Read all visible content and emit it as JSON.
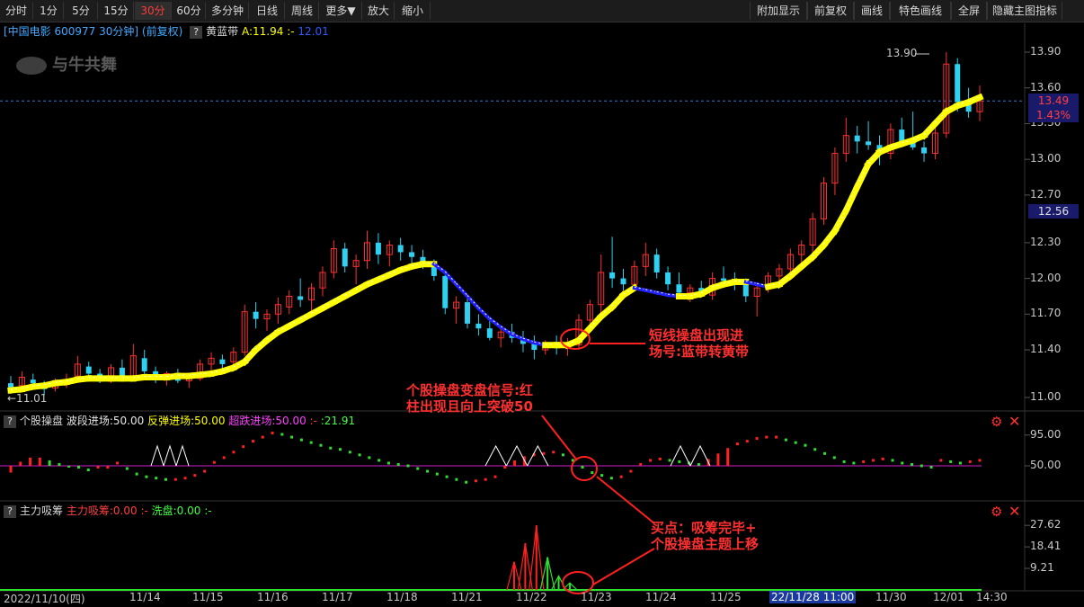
{
  "toolbar": {
    "left": [
      "分时",
      "1分",
      "5分",
      "15分",
      "30分",
      "60分",
      "多分钟",
      "日线",
      "周线",
      "更多▼",
      "放大",
      "缩小"
    ],
    "active_index": 4,
    "right": [
      "附加显示",
      "前复权",
      "画线",
      "特色画线",
      "全屏",
      "隐藏主图指标"
    ]
  },
  "header": {
    "stock": "[中国电影 600977 30分钟]",
    "adjust": "(前复权)",
    "qm": "?",
    "indicator": "黄蓝带",
    "a_value": "A:11.94",
    "b_value": ":-",
    "c_value": "12.01",
    "watermark": "与牛共舞"
  },
  "main_axis": {
    "ticks": [
      "13.90",
      "13.60",
      "13.30",
      "13.00",
      "12.70",
      "12.30",
      "12.00",
      "11.70",
      "11.40",
      "11.00"
    ],
    "current_price": "13.49",
    "current_pct": "1.43%",
    "level": "12.56",
    "high_label": "13.90",
    "low_label": "11.01"
  },
  "sub1": {
    "title": "个股操盘",
    "l1": "波段进场:50.00",
    "l2": "反弹进场:50.00",
    "l3": "超跌进场:50.00",
    "l4": ":-",
    "l5": ":21.91",
    "ticks": [
      "95.00",
      "50.00"
    ],
    "colors": {
      "l1": "#e6e6e6",
      "l2": "#ffff00",
      "l3": "#ff40ff",
      "l5": "#40ff40"
    }
  },
  "sub2": {
    "title": "主力吸筹",
    "l1": "主力吸筹:0.00",
    "l2": ":-",
    "l3": "洗盘:0.00",
    "l4": ":-",
    "ticks": [
      "27.62",
      "18.41",
      "9.21"
    ]
  },
  "x_axis": {
    "labels": [
      "2022/11/10(四)",
      "11/14",
      "11/15",
      "11/16",
      "11/17",
      "11/18",
      "11/21",
      "11/22",
      "11/23",
      "11/24",
      "11/25",
      "11/28",
      "11/30",
      "12/01",
      "14:30"
    ],
    "cursor_label": "22/11/28 11:00"
  },
  "annotations": {
    "a1_l1": "短线操盘出现进",
    "a1_l2": "场号:蓝带转黄带",
    "a2_l1": "个股操盘变盘信号:红",
    "a2_l2": "柱出现且向上突破50",
    "a3_l1": "买点：吸筹完毕+",
    "a3_l2": "个股操盘主题上移"
  },
  "chart_data": [
    {
      "type": "candlestick",
      "title": "中国电影 600977 30分钟",
      "ylim": [
        11.0,
        13.9
      ],
      "series": [
        {
          "name": "黄蓝带",
          "values": [
            11.06,
            11.07,
            11.09,
            11.1,
            11.12,
            11.13,
            11.15,
            11.16,
            11.16,
            11.16,
            11.16,
            11.16,
            11.17,
            11.17,
            11.17,
            11.18,
            11.18,
            11.19,
            11.2,
            11.22,
            11.25,
            11.3,
            11.4,
            11.48,
            11.55,
            11.6,
            11.65,
            11.7,
            11.75,
            11.8,
            11.85,
            11.9,
            11.95,
            11.99,
            12.03,
            12.07,
            12.1,
            12.12,
            12.12,
            12.05,
            11.95,
            11.85,
            11.75,
            11.66,
            11.59,
            11.53,
            11.49,
            11.46,
            11.44,
            11.44,
            11.44,
            11.48,
            11.58,
            11.68,
            11.76,
            11.86,
            11.92,
            11.9,
            11.88,
            11.86,
            11.85,
            11.85,
            11.87,
            11.92,
            11.95,
            11.97,
            11.97,
            11.95,
            11.93,
            11.95,
            12.02,
            12.1,
            12.18,
            12.28,
            12.4,
            12.57,
            12.77,
            12.96,
            13.06,
            13.1,
            13.13,
            13.16,
            13.2,
            13.3,
            13.4,
            13.45,
            13.48,
            13.52
          ]
        }
      ],
      "ohlc": [
        [
          11.12,
          11.18,
          11.03,
          11.08
        ],
        [
          11.1,
          11.22,
          11.05,
          11.17
        ],
        [
          11.15,
          11.2,
          11.08,
          11.12
        ],
        [
          11.1,
          11.14,
          11.02,
          11.07
        ],
        [
          11.08,
          11.16,
          11.05,
          11.13
        ],
        [
          11.12,
          11.2,
          11.08,
          11.15
        ],
        [
          11.18,
          11.35,
          11.15,
          11.28
        ],
        [
          11.26,
          11.3,
          11.16,
          11.2
        ],
        [
          11.2,
          11.24,
          11.12,
          11.15
        ],
        [
          11.15,
          11.28,
          11.12,
          11.25
        ],
        [
          11.25,
          11.32,
          11.15,
          11.18
        ],
        [
          11.17,
          11.45,
          11.15,
          11.35
        ],
        [
          11.33,
          11.4,
          11.18,
          11.22
        ],
        [
          11.22,
          11.26,
          11.12,
          11.16
        ],
        [
          11.16,
          11.22,
          11.1,
          11.2
        ],
        [
          11.18,
          11.24,
          11.12,
          11.14
        ],
        [
          11.14,
          11.2,
          11.08,
          11.17
        ],
        [
          11.16,
          11.32,
          11.14,
          11.28
        ],
        [
          11.28,
          11.38,
          11.22,
          11.33
        ],
        [
          11.32,
          11.36,
          11.24,
          11.28
        ],
        [
          11.3,
          11.42,
          11.26,
          11.38
        ],
        [
          11.38,
          11.78,
          11.35,
          11.72
        ],
        [
          11.72,
          11.8,
          11.58,
          11.66
        ],
        [
          11.66,
          11.74,
          11.56,
          11.7
        ],
        [
          11.7,
          11.84,
          11.62,
          11.78
        ],
        [
          11.76,
          11.9,
          11.7,
          11.85
        ],
        [
          11.85,
          12.0,
          11.76,
          11.82
        ],
        [
          11.82,
          11.96,
          11.7,
          11.92
        ],
        [
          11.92,
          12.1,
          11.85,
          12.05
        ],
        [
          12.05,
          12.32,
          12.0,
          12.25
        ],
        [
          12.25,
          12.3,
          12.05,
          12.1
        ],
        [
          12.1,
          12.2,
          11.95,
          12.15
        ],
        [
          12.15,
          12.4,
          12.08,
          12.3
        ],
        [
          12.3,
          12.38,
          12.12,
          12.2
        ],
        [
          12.2,
          12.32,
          12.1,
          12.28
        ],
        [
          12.28,
          12.34,
          12.15,
          12.22
        ],
        [
          12.22,
          12.28,
          12.1,
          12.18
        ],
        [
          12.18,
          12.24,
          12.08,
          12.12
        ],
        [
          12.12,
          12.16,
          11.98,
          12.02
        ],
        [
          12.02,
          12.06,
          11.7,
          11.75
        ],
        [
          11.75,
          11.85,
          11.62,
          11.8
        ],
        [
          11.8,
          11.84,
          11.58,
          11.62
        ],
        [
          11.62,
          11.7,
          11.52,
          11.58
        ],
        [
          11.58,
          11.66,
          11.48,
          11.5
        ],
        [
          11.5,
          11.58,
          11.42,
          11.55
        ],
        [
          11.55,
          11.62,
          11.46,
          11.5
        ],
        [
          11.5,
          11.56,
          11.38,
          11.45
        ],
        [
          11.45,
          11.52,
          11.32,
          11.4
        ],
        [
          11.4,
          11.48,
          11.36,
          11.46
        ],
        [
          11.46,
          11.52,
          11.36,
          11.42
        ],
        [
          11.42,
          11.5,
          11.35,
          11.46
        ],
        [
          11.44,
          11.7,
          11.4,
          11.65
        ],
        [
          11.65,
          11.82,
          11.6,
          11.78
        ],
        [
          11.78,
          12.2,
          11.7,
          12.05
        ],
        [
          12.05,
          12.35,
          11.92,
          12.0
        ],
        [
          12.0,
          12.08,
          11.9,
          11.95
        ],
        [
          11.95,
          12.15,
          11.9,
          12.1
        ],
        [
          12.1,
          12.3,
          12.02,
          12.2
        ],
        [
          12.2,
          12.25,
          12.0,
          12.05
        ],
        [
          12.05,
          12.1,
          11.9,
          11.95
        ],
        [
          11.95,
          12.05,
          11.85,
          11.88
        ],
        [
          11.88,
          11.95,
          11.8,
          11.92
        ],
        [
          11.92,
          11.98,
          11.84,
          11.86
        ],
        [
          11.86,
          12.05,
          11.82,
          12.0
        ],
        [
          12.0,
          12.1,
          11.92,
          11.98
        ],
        [
          11.98,
          12.05,
          11.9,
          11.95
        ],
        [
          11.95,
          12.0,
          11.8,
          11.85
        ],
        [
          11.85,
          11.95,
          11.68,
          11.92
        ],
        [
          11.92,
          12.05,
          11.88,
          12.02
        ],
        [
          12.02,
          12.12,
          11.95,
          12.08
        ],
        [
          12.08,
          12.25,
          12.02,
          12.2
        ],
        [
          12.2,
          12.32,
          12.1,
          12.28
        ],
        [
          12.28,
          12.55,
          12.2,
          12.5
        ],
        [
          12.5,
          12.85,
          12.45,
          12.8
        ],
        [
          12.8,
          13.1,
          12.7,
          13.05
        ],
        [
          13.05,
          13.35,
          12.98,
          13.2
        ],
        [
          13.2,
          13.28,
          13.05,
          13.15
        ],
        [
          13.15,
          13.32,
          13.08,
          13.12
        ],
        [
          13.12,
          13.2,
          12.95,
          13.05
        ],
        [
          13.05,
          13.3,
          13.0,
          13.25
        ],
        [
          13.25,
          13.35,
          13.1,
          13.15
        ],
        [
          13.15,
          13.4,
          13.08,
          13.1
        ],
        [
          13.1,
          13.15,
          12.98,
          13.05
        ],
        [
          13.05,
          13.3,
          13.0,
          13.22
        ],
        [
          13.22,
          13.9,
          13.18,
          13.8
        ],
        [
          13.8,
          13.85,
          13.4,
          13.48
        ],
        [
          13.48,
          13.6,
          13.35,
          13.4
        ],
        [
          13.4,
          13.62,
          13.32,
          13.49
        ]
      ]
    },
    {
      "type": "bar",
      "title": "个股操盘",
      "ylim": [
        0,
        100
      ],
      "values": [
        40,
        56,
        62,
        62,
        58,
        54,
        50,
        46,
        44,
        48,
        48,
        54,
        46,
        38,
        34,
        32,
        30,
        30,
        32,
        36,
        42,
        55,
        62,
        70,
        78,
        86,
        92,
        98,
        96,
        92,
        88,
        84,
        80,
        76,
        74,
        70,
        66,
        62,
        58,
        54,
        52,
        50,
        46,
        42,
        38,
        34,
        30,
        26,
        28,
        30,
        34,
        46,
        58,
        64,
        66,
        68,
        70,
        66,
        58,
        48,
        40,
        36,
        32,
        34,
        42,
        52,
        58,
        60,
        58,
        56,
        54,
        52,
        60,
        68,
        76,
        82,
        86,
        90,
        92,
        92,
        88,
        84,
        80,
        74,
        68,
        62,
        56,
        54,
        56,
        58,
        60,
        58,
        54,
        52,
        50,
        48,
        58,
        56,
        54,
        56,
        58
      ],
      "reference": 50
    },
    {
      "type": "bar",
      "title": "主力吸筹",
      "ylim": [
        0,
        30
      ],
      "series": [
        {
          "name": "主力吸筹",
          "values": [
            0,
            0,
            0,
            0,
            0,
            0,
            0,
            0,
            0,
            0,
            0,
            0,
            0,
            0,
            0,
            0,
            0,
            0,
            0,
            0,
            0,
            0,
            0,
            0,
            0,
            0,
            0,
            0,
            0,
            0,
            0,
            0,
            0,
            0,
            0,
            0,
            0,
            0,
            0,
            0,
            0,
            0,
            0,
            0,
            0,
            0,
            0,
            0,
            0,
            0,
            0,
            0,
            0,
            0,
            0,
            0,
            0,
            0,
            0,
            0,
            0,
            0,
            0,
            0,
            0,
            0,
            0,
            0,
            0,
            0,
            0,
            0,
            0,
            0,
            0,
            0,
            0,
            0,
            0,
            0,
            0,
            0,
            0,
            0,
            0,
            0,
            0,
            0
          ]
        },
        {
          "name": "洗盘",
          "values": [
            0,
            0,
            0,
            0,
            0,
            0,
            0,
            0,
            0,
            0,
            0,
            0,
            0,
            0,
            0,
            0,
            0,
            0,
            0,
            0,
            0,
            0,
            0,
            0,
            0,
            0,
            0,
            0,
            0,
            0,
            0,
            0,
            0,
            0,
            0,
            0,
            0,
            0,
            0,
            0,
            0,
            0,
            0,
            0,
            0,
            0,
            0,
            0,
            0,
            0,
            0,
            0,
            0,
            0,
            0,
            0,
            0,
            0,
            0,
            0,
            0,
            0,
            0,
            0,
            0,
            0,
            0,
            0,
            0,
            0,
            0,
            0,
            0,
            0,
            0,
            0,
            0,
            0,
            0,
            0,
            0,
            0,
            0,
            0,
            0,
            0,
            0,
            0
          ]
        }
      ],
      "spikes": [
        [
          46,
          12
        ],
        [
          47,
          20
        ],
        [
          48,
          27.6
        ],
        [
          49,
          14
        ],
        [
          50,
          6
        ],
        [
          51,
          3
        ]
      ]
    }
  ]
}
